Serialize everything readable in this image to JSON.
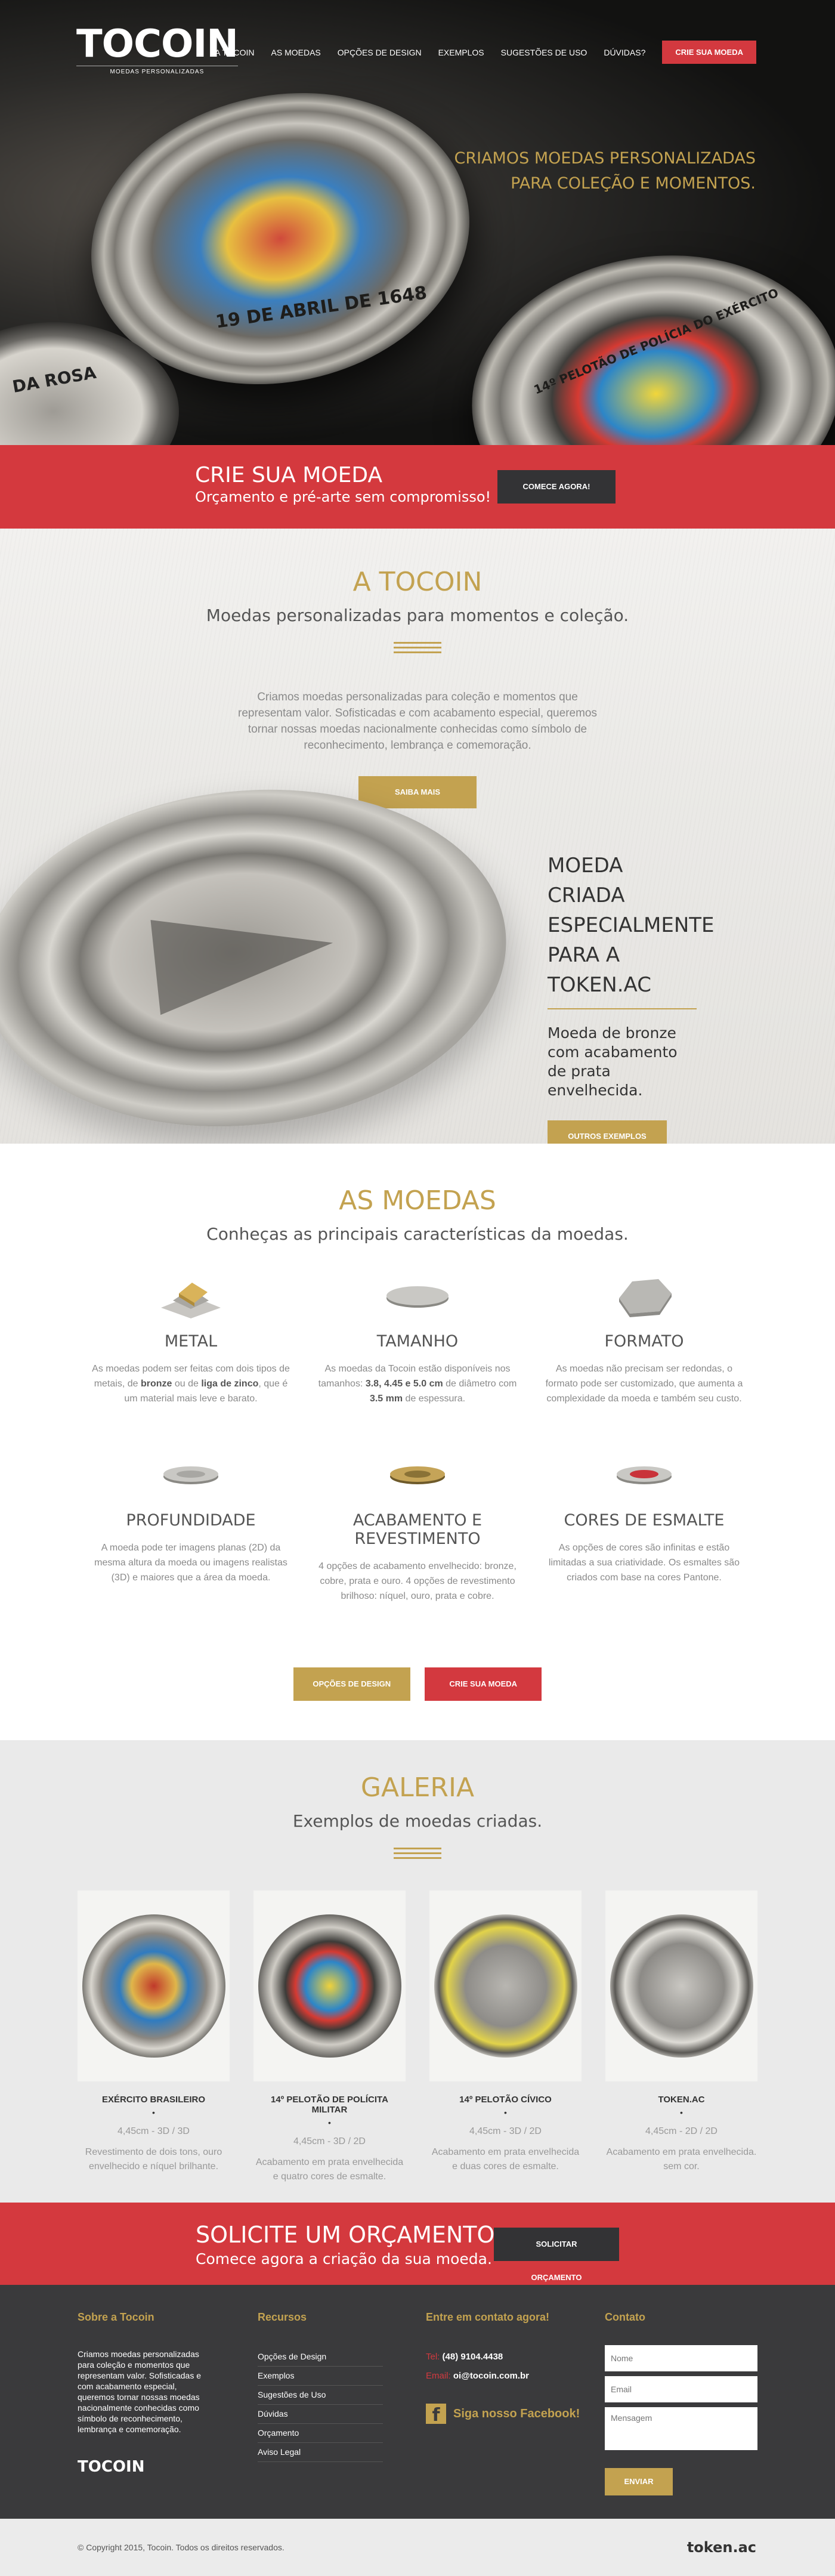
{
  "brand": {
    "logo": "TOCOIN",
    "tagline": "MOEDAS PERSONALIZADAS",
    "accent_gold": "#c3a250",
    "accent_red": "#d4393e",
    "dark": "#3a3a3c"
  },
  "nav": {
    "items": [
      "A TOCOIN",
      "AS MOEDAS",
      "OPÇÕES DE DESIGN",
      "EXEMPLOS",
      "SUGESTÕES DE USO",
      "DÚVIDAS?"
    ],
    "cta": "CRIE SUA MOEDA"
  },
  "hero": {
    "line1": "CRIAMOS MOEDAS PERSONALIZADAS",
    "line2": "PARA COLEÇÃO E MOMENTOS.",
    "coin_text_1": "19 DE ABRIL DE 1648",
    "coin_text_2": "14º PELOTÃO DE POLÍCIA DO EXÉRCITO",
    "coin_text_3": "DA ROSA"
  },
  "crie_banner": {
    "title": "CRIE SUA MOEDA",
    "subtitle": "Orçamento e pré-arte sem compromisso!",
    "button": "COMECE AGORA!"
  },
  "about": {
    "title": "A TOCOIN",
    "subtitle": "Moedas personalizadas para momentos e coleção.",
    "body": "Criamos moedas personalizadas para coleção e momentos que representam valor. Sofisticadas e com acabamento especial, queremos tornar nossas moedas nacionalmente conhecidas como símbolo de reconhecimento, lembrança e comemoração.",
    "button": "SAIBA MAIS",
    "token_title": "MOEDA CRIADA ESPECIALMENTE PARA A TOKEN.AC",
    "token_text": "Moeda de bronze com acabamento de prata envelhecida.",
    "token_button": "OUTROS EXEMPLOS"
  },
  "moedas": {
    "title": "AS MOEDAS",
    "subtitle": "Conheças as principais características da moedas.",
    "features": [
      {
        "icon": "metal-bars-icon",
        "title": "METAL",
        "desc": "As moedas podem ser feitas com dois tipos de metais, de bronze ou de liga de zinco, que é um material mais leve e barato."
      },
      {
        "icon": "coin-size-icon",
        "title": "TAMANHO",
        "desc": "As moedas da Tocoin estão disponíveis nos tamanhos: 3.8, 4.45 e 5.0 cm de diâmetro com 3.5 mm de espessura."
      },
      {
        "icon": "coin-shape-icon",
        "title": "FORMATO",
        "desc": "As moedas não precisam ser redondas, o formato pode ser customizado, que aumenta a complexidade da moeda e também seu custo."
      },
      {
        "icon": "coin-depth-icon",
        "title": "PROFUNDIDADE",
        "desc": "A moeda pode ter imagens planas (2D) da mesma altura da moeda ou imagens realistas (3D) e maiores que a área da moeda."
      },
      {
        "icon": "coin-finish-icon",
        "title": "ACABAMENTO E REVESTIMENTO",
        "desc": "4 opções de acabamento envelhecido: bronze, cobre, prata e ouro. 4 opções de revestimento brilhoso: níquel, ouro, prata e cobre."
      },
      {
        "icon": "coin-enamel-icon",
        "title": "CORES DE ESMALTE",
        "desc": "As opções de cores são infinitas e estão limitadas a sua criatividade. Os esmaltes são criados com base na cores Pantone."
      }
    ],
    "button_design": "OPÇÕES DE DESIGN",
    "button_crie": "CRIE SUA MOEDA"
  },
  "galeria": {
    "title": "GALERIA",
    "subtitle": "Exemplos de moedas criadas.",
    "items": [
      {
        "name": "EXÉRCITO BRASILEIRO",
        "spec": "4,45cm - 3D / 3D",
        "desc": "Revestimento de dois tons, ouro envelhecido e níquel brilhante."
      },
      {
        "name": "14º PELOTÃO DE POLÍCITA MILITAR",
        "spec": "4,45cm - 3D / 2D",
        "desc": "Acabamento em prata envelhecida e quatro cores de esmalte."
      },
      {
        "name": "14º PELOTÃO CÍVICO",
        "spec": "4,45cm - 3D / 2D",
        "desc": "Acabamento em prata envelhecida e duas cores de esmalte."
      },
      {
        "name": "TOKEN.AC",
        "spec": "4,45cm - 2D / 2D",
        "desc": "Acabamento em prata envelhecida. sem cor."
      }
    ]
  },
  "orcamento": {
    "title": "SOLICITE UM ORÇAMENTO",
    "subtitle": "Comece agora a criação da sua moeda.",
    "button": "SOLICITAR ORÇAMENTO"
  },
  "footer": {
    "about_title": "Sobre a Tocoin",
    "about_text": "Criamos moedas personalizadas para coleção e momentos que representam valor. Sofisticadas e com acabamento especial, queremos tornar nossas moedas nacionalmente conhecidas como símbolo de reconhecimento, lembrança e comemoração.",
    "resources_title": "Recursos",
    "resources": [
      "Opções de Design",
      "Exemplos",
      "Sugestões de Uso",
      "Dúvidas",
      "Orçamento",
      "Aviso Legal"
    ],
    "contact_title": "Entre em contato agora!",
    "tel_label": "Tel:",
    "tel": "(48) 9104.4438",
    "email_label": "Email:",
    "email": "oi@tocoin.com.br",
    "facebook": "Siga nosso Facebook!",
    "form_title": "Contato",
    "name_placeholder": "Nome",
    "email_placeholder": "Email",
    "message_placeholder": "Mensagem",
    "send": "ENVIAR",
    "logo": "TOCOIN",
    "copyright": "© Copyright 2015, Tocoin. Todos os direitos reservados.",
    "credit": "token.ac"
  }
}
